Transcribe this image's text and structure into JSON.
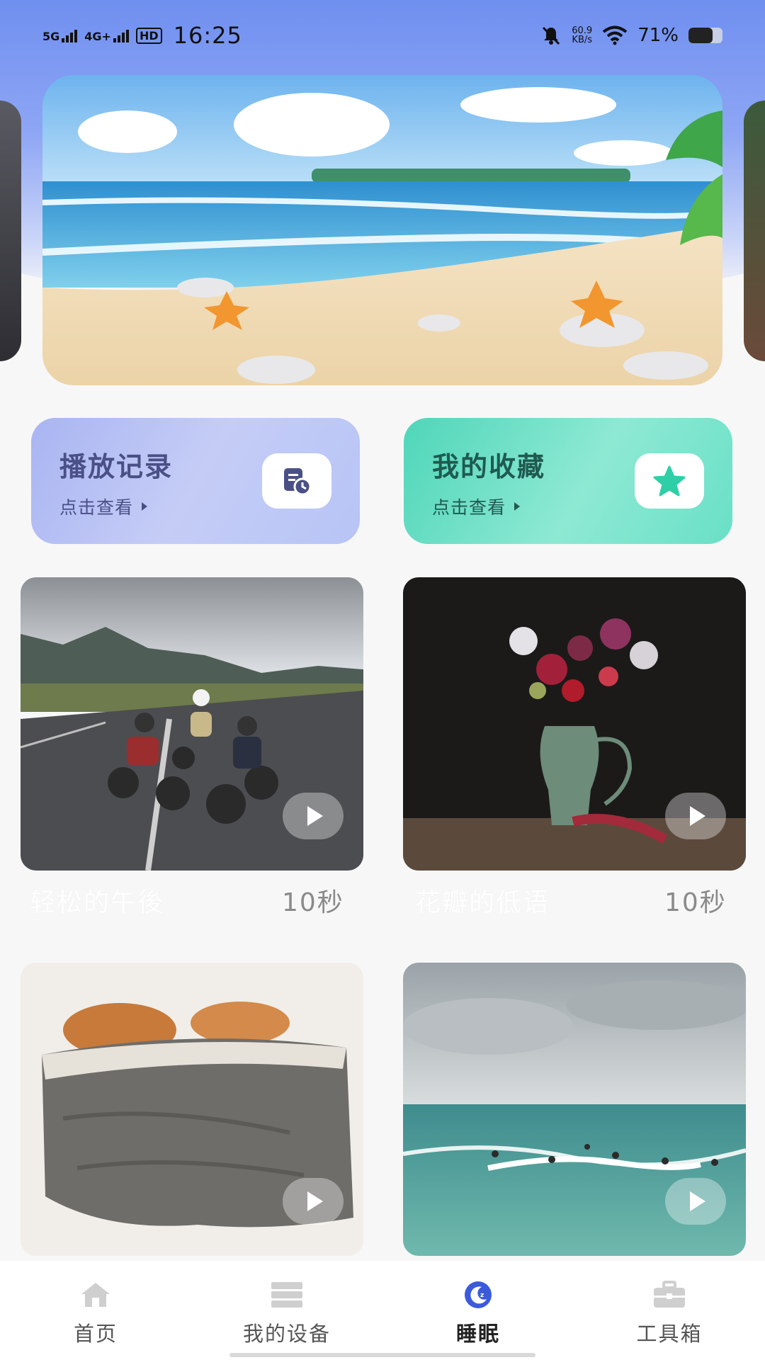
{
  "status_bar": {
    "signal1_label": "5G",
    "signal2_label": "4G+",
    "hd_label": "HD",
    "time": "16:25",
    "net_speed_value": "60.9",
    "net_speed_unit": "KB/s",
    "battery_text": "71%",
    "battery_level": 0.71
  },
  "quick_cards": {
    "history": {
      "title": "播放记录",
      "subtitle": "点击查看",
      "icon": "history-doc-clock-icon",
      "color": "#4a5086"
    },
    "favorite": {
      "title": "我的收藏",
      "subtitle": "点击查看",
      "icon": "star-icon",
      "color": "#2ecfa6"
    }
  },
  "grid": {
    "items": [
      {
        "title": "轻松的午後",
        "duration": "10秒",
        "image": "motorcycle-riders-road"
      },
      {
        "title": "花瓣的低语",
        "duration": "10秒",
        "image": "flower-vase-dark"
      },
      {
        "title": "",
        "duration": "",
        "image": "cats-under-blanket"
      },
      {
        "title": "",
        "duration": "",
        "image": "surfers-ocean"
      }
    ]
  },
  "bottom_nav": {
    "items": [
      {
        "label": "首页",
        "icon": "home-icon"
      },
      {
        "label": "我的设备",
        "icon": "device-icon"
      },
      {
        "label": "睡眠",
        "icon": "moon-icon"
      },
      {
        "label": "工具箱",
        "icon": "toolbox-icon"
      }
    ],
    "active_index": 2,
    "active_color": "#3b5bdb"
  }
}
